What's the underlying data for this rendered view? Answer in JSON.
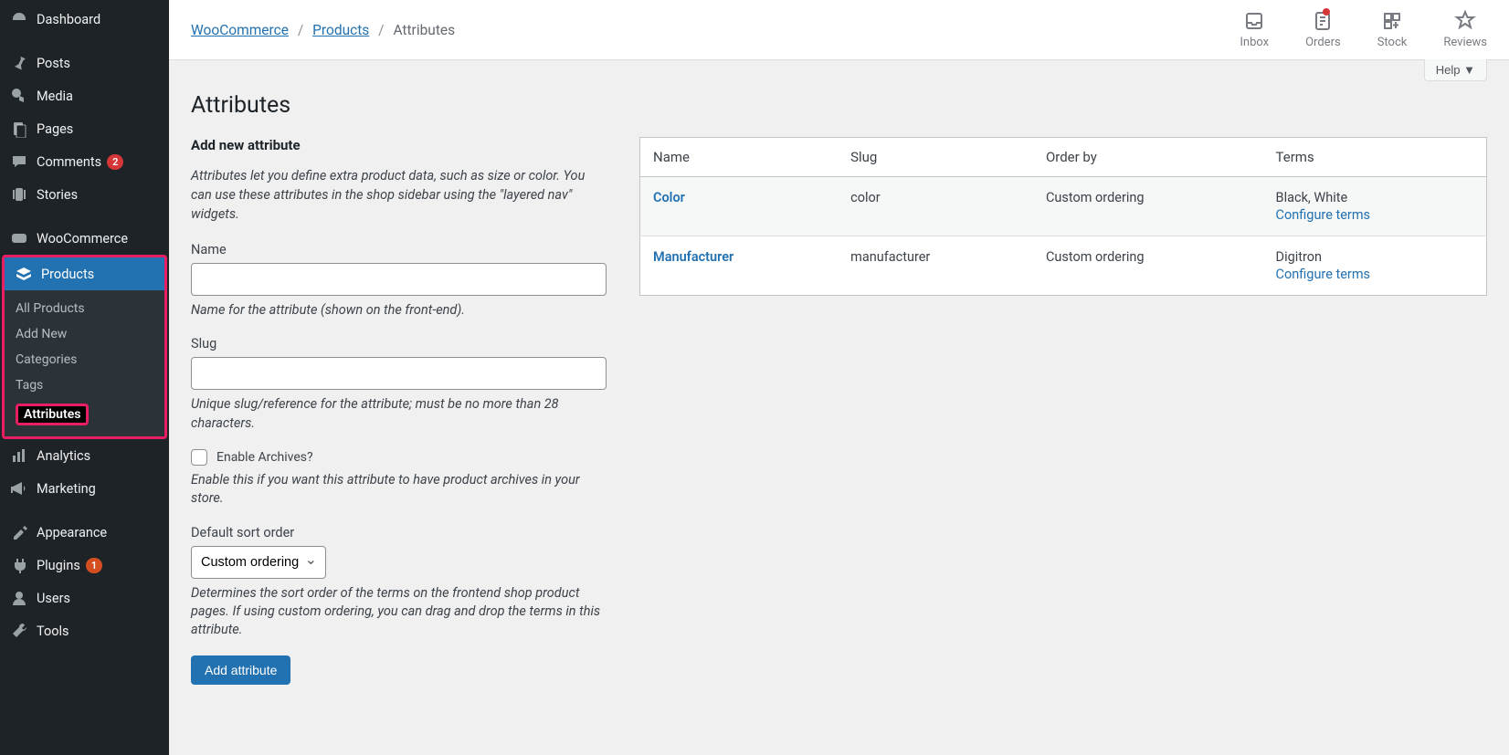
{
  "sidebar": {
    "items": [
      {
        "label": "Dashboard",
        "icon": "dashboard"
      },
      {
        "label": "Posts",
        "icon": "pin"
      },
      {
        "label": "Media",
        "icon": "media"
      },
      {
        "label": "Pages",
        "icon": "pages"
      },
      {
        "label": "Comments",
        "icon": "comments",
        "badge": "2"
      },
      {
        "label": "Stories",
        "icon": "stories"
      },
      {
        "label": "WooCommerce",
        "icon": "woo"
      },
      {
        "label": "Products",
        "icon": "products",
        "active": true
      },
      {
        "label": "Analytics",
        "icon": "analytics"
      },
      {
        "label": "Marketing",
        "icon": "marketing"
      },
      {
        "label": "Appearance",
        "icon": "appearance"
      },
      {
        "label": "Plugins",
        "icon": "plugins",
        "badge": "1",
        "badgeStyle": "orange"
      },
      {
        "label": "Users",
        "icon": "users"
      },
      {
        "label": "Tools",
        "icon": "tools"
      }
    ],
    "submenu": [
      {
        "label": "All Products"
      },
      {
        "label": "Add New"
      },
      {
        "label": "Categories"
      },
      {
        "label": "Tags"
      },
      {
        "label": "Attributes",
        "current": true
      }
    ]
  },
  "breadcrumb": {
    "links": [
      "WooCommerce",
      "Products"
    ],
    "current": "Attributes",
    "sep": "/"
  },
  "topActions": [
    {
      "label": "Inbox",
      "icon": "inbox"
    },
    {
      "label": "Orders",
      "icon": "orders",
      "dot": true
    },
    {
      "label": "Stock",
      "icon": "stock"
    },
    {
      "label": "Reviews",
      "icon": "reviews"
    }
  ],
  "helpBtn": "Help ▼",
  "pageTitle": "Attributes",
  "form": {
    "title": "Add new attribute",
    "intro": "Attributes let you define extra product data, such as size or color. You can use these attributes in the shop sidebar using the \"layered nav\" widgets.",
    "name": {
      "label": "Name",
      "help": "Name for the attribute (shown on the front-end)."
    },
    "slug": {
      "label": "Slug",
      "help": "Unique slug/reference for the attribute; must be no more than 28 characters."
    },
    "archives": {
      "label": "Enable Archives?",
      "help": "Enable this if you want this attribute to have product archives in your store."
    },
    "sort": {
      "label": "Default sort order",
      "selected": "Custom ordering",
      "help": "Determines the sort order of the terms on the frontend shop product pages. If using custom ordering, you can drag and drop the terms in this attribute."
    },
    "submit": "Add attribute"
  },
  "table": {
    "headers": [
      "Name",
      "Slug",
      "Order by",
      "Terms"
    ],
    "rows": [
      {
        "name": "Color",
        "slug": "color",
        "order": "Custom ordering",
        "terms": "Black, White",
        "configure": "Configure terms"
      },
      {
        "name": "Manufacturer",
        "slug": "manufacturer",
        "order": "Custom ordering",
        "terms": "Digitron",
        "configure": "Configure terms"
      }
    ]
  }
}
